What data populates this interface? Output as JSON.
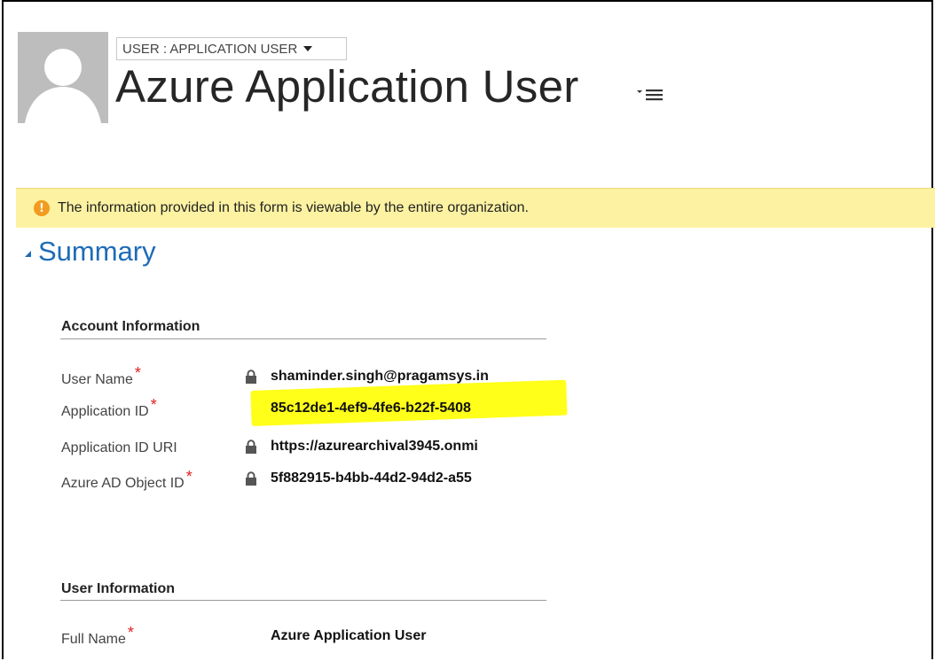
{
  "header": {
    "form_selector_label": "USER : APPLICATION USER",
    "record_title": "Azure Application User"
  },
  "notice": {
    "text": "The information provided in this form is viewable by the entire organization."
  },
  "section": {
    "title": "Summary"
  },
  "account_information": {
    "title": "Account Information",
    "fields": [
      {
        "label": "User Name",
        "required": "*",
        "value": "shaminder.singh@pragamsys.in",
        "locked": true
      },
      {
        "label": "Application ID",
        "required": "*",
        "value": "85c12de1-4ef9-4fe6-b22f-5408",
        "locked": false,
        "highlighted": true
      },
      {
        "label": "Application ID URI",
        "required": "",
        "value": "https://azurearchival3945.onmi",
        "locked": true
      },
      {
        "label": "Azure AD Object ID",
        "required": "*",
        "value": "5f882915-b4bb-44d2-94d2-a55",
        "locked": true
      }
    ]
  },
  "user_information": {
    "title": "User Information",
    "fields": [
      {
        "label": "Full Name",
        "required": "*",
        "value": "Azure Application User",
        "locked": false
      }
    ]
  },
  "colors": {
    "accent": "#1e6bb8",
    "notice_bg": "#fcf2a2",
    "highlight": "#ffff1a",
    "required": "#e02020"
  },
  "icons": {
    "avatar": "user-silhouette-icon",
    "form_caret": "caret-down-icon",
    "title_menu": "menu-lines-icon",
    "notice": "warning-icon",
    "section_toggle": "triangle-collapse-icon",
    "lock": "lock-icon"
  }
}
